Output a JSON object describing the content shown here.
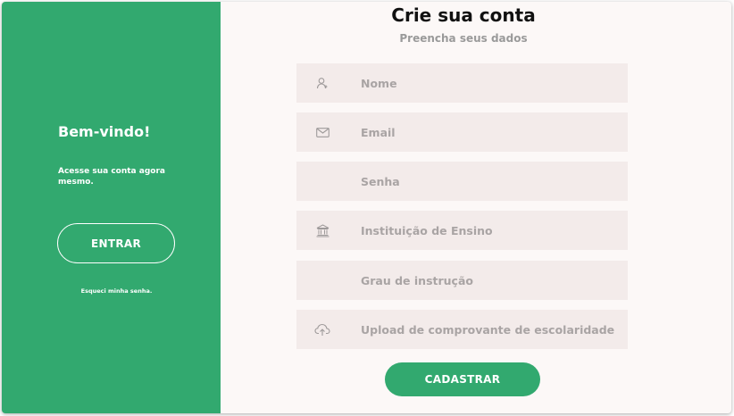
{
  "left_panel": {
    "title": "Bem-vindo!",
    "subtitle": "Acesse sua conta agora mesmo.",
    "login_button": "ENTRAR",
    "forgot_link": "Esqueci minha senha."
  },
  "form": {
    "title": "Crie sua conta",
    "subtitle": "Preencha seus dados",
    "fields": [
      {
        "placeholder": "Nome",
        "icon": "user-icon"
      },
      {
        "placeholder": "Email",
        "icon": "mail-icon"
      },
      {
        "placeholder": "Senha",
        "icon": ""
      },
      {
        "placeholder": "Instituição de Ensino",
        "icon": "institution-icon"
      },
      {
        "placeholder": "Grau de instrução",
        "icon": ""
      },
      {
        "placeholder": "Upload de comprovante de escolaridade",
        "icon": "cloud-upload-icon"
      }
    ],
    "submit_button": "CADASTRAR"
  },
  "colors": {
    "accent": "#32a96f",
    "field_bg": "#f3ebea",
    "page_bg": "#fcf8f7"
  }
}
